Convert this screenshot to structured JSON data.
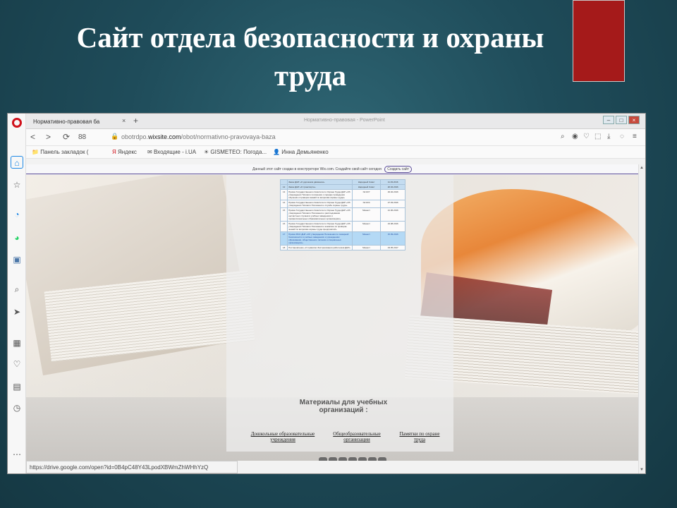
{
  "slide": {
    "title_line1": "Сайт отдела безопасности и охраны",
    "title_line2": "труда"
  },
  "browser": {
    "tab_title": "Нормативно-правовая ба",
    "tab_close": "×",
    "tab_new": "+",
    "window_title": "Нормативно-правовая - PowerPoint",
    "win_buttons": {
      "minimize": "–",
      "maximize": "□",
      "close": "×"
    },
    "zoom_badge": "88",
    "url_prefix": "obotrdpo.",
    "url_domain": "wixsite.com",
    "url_path": "/obot/normativno-pravovaya-baza",
    "bookmarks": [
      "Панель закладок (",
      "Яндекс",
      "Входящие - i.UA",
      "GISMETEO: Погода...",
      "Инна Демьяненко"
    ],
    "wix_banner": "Данный этот сайт создан в конструкторе Wix.com. Создайте свой сайт сегодня",
    "wix_button": "Создать сайт",
    "status_url": "https://drive.google.com/open?id=0B4pC48Y43LpodXBWmZhWHhYzQ"
  },
  "doc_table": {
    "rows": [
      {
        "n": "",
        "title": "Закон ДНР «О дорожном движении»",
        "author": "Народный Совет",
        "date": "11.03.2016",
        "style": "blue"
      },
      {
        "n": "12",
        "title": "Закон ДНР «О транспорте»",
        "author": "Народный Совет",
        "date": "20.04.2016",
        "style": "blue"
      },
      {
        "n": "13",
        "title": "Приказ Государственного Комитета по Охране Труда ДНР «Об утверждении Типового положения о порядке проведения обучения и проверки знаний по вопросам охраны труда»",
        "author": "№ 02/7",
        "date": "29.02.2016",
        "style": ""
      },
      {
        "n": "14",
        "title": "Приказ Государственного Комитета по Охране Труда ДНР «Об утверждении Типового Положения о службе охраны труда»",
        "author": "№ 02/4",
        "date": "27.03.2016",
        "style": ""
      },
      {
        "n": "15",
        "title": "Приказ Государственного Комитета по Охране Труда ДНР «Об утверждении Типового Положения о расследовании несчастных случаев в учебных заведениях и профессиональных образовательных организациях»",
        "author": "Минюст",
        "date": "21.06.2016",
        "style": ""
      },
      {
        "n": "16",
        "title": "Приказ Государственного Комитета по Охране Труда ДНР «Об утверждении Типового Положения о комиссии по проверке знаний по вопросам охраны труда предприятий»",
        "author": "Минюст",
        "date": "23.08.2016",
        "style": ""
      },
      {
        "n": "17",
        "title": "Приказ МЧС ДНР «Об утверждении Положения по пожарной безопасности в учебных заведениях и учреждениях образования, общественного питания и специальных организациях»",
        "author": "Минюст",
        "date": "15.09.2016",
        "style": "hl"
      },
      {
        "n": "18",
        "title": "Постановление «О правилах Застраховании работников ДНР»",
        "author": "Минюст",
        "date": "03.05.2017",
        "style": ""
      }
    ]
  },
  "materials": {
    "title": "Материалы для учебных организаций :",
    "links": [
      "Дошкольные образовательные учреждения",
      "Общеобразовательные организации",
      "Памятки по охране труда"
    ]
  }
}
